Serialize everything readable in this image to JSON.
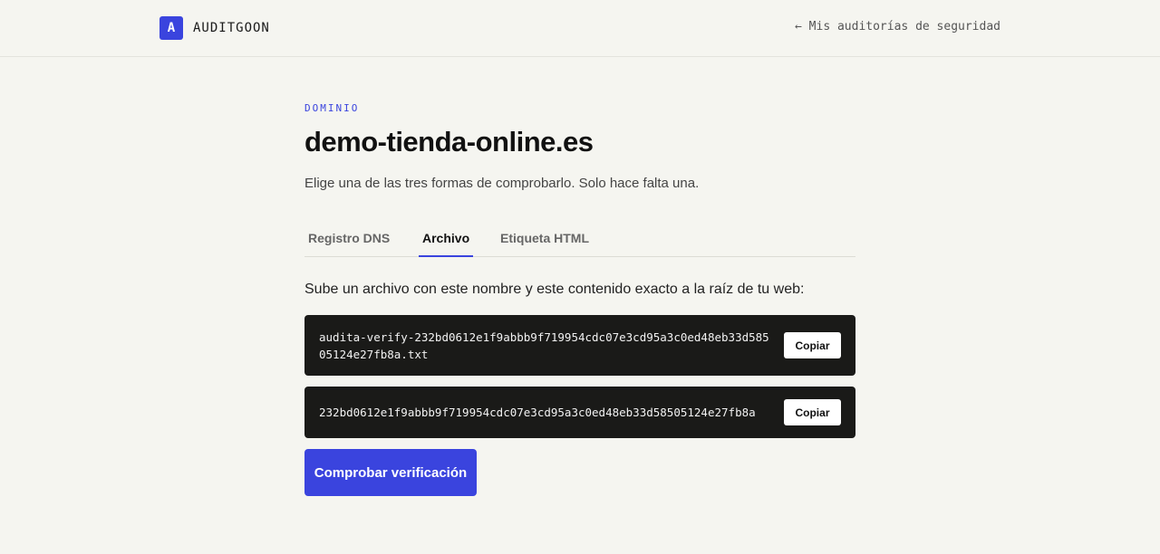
{
  "header": {
    "logo_letter": "A",
    "brand": "AUDITGOON",
    "back_link": "← Mis auditorías de seguridad"
  },
  "main": {
    "eyebrow": "DOMINIO",
    "domain": "demo-tienda-online.es",
    "subtitle": "Elige una de las tres formas de comprobarlo. Solo hace falta una.",
    "tabs": [
      {
        "label": "Registro DNS",
        "active": false
      },
      {
        "label": "Archivo",
        "active": true
      },
      {
        "label": "Etiqueta HTML",
        "active": false
      }
    ],
    "instructions": "Sube un archivo con este nombre y este contenido exacto a la raíz de tu web:",
    "filename": "audita-verify-232bd0612e1f9abbb9f719954cdc07e3cd95a3c0ed48eb33d58505124e27fb8a.txt",
    "content": "232bd0612e1f9abbb9f719954cdc07e3cd95a3c0ed48eb33d58505124e27fb8a",
    "copy_label": "Copiar",
    "verify_label": "Comprobar verificación"
  },
  "colors": {
    "accent": "#3a44de",
    "background": "#f5f5f0",
    "code_background": "#1a1a18"
  }
}
